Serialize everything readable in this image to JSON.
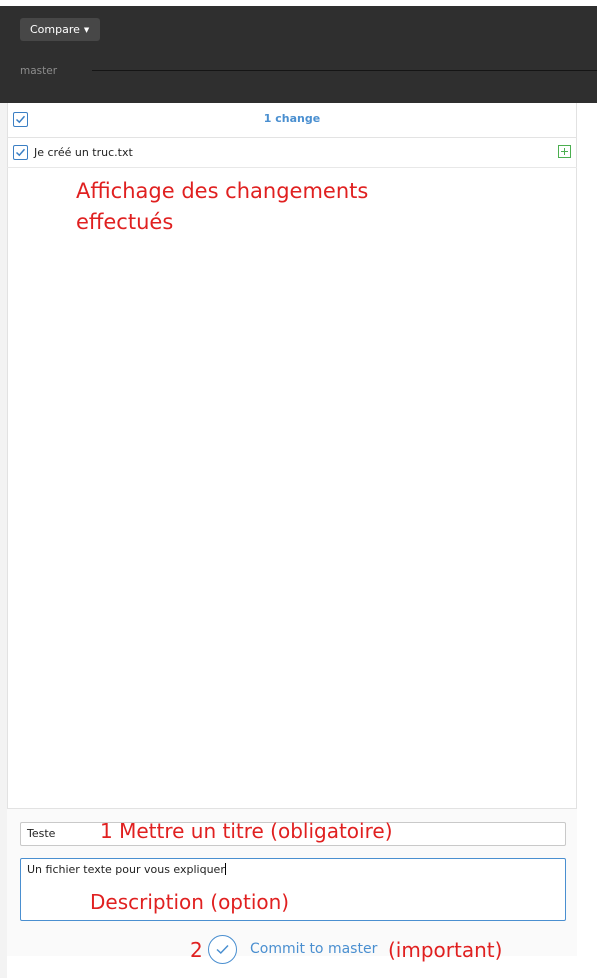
{
  "toolbar": {
    "compare_label": "Compare",
    "compare_caret_icon": "caret-down-icon",
    "branch_label": "master"
  },
  "changes": {
    "count_label": "1 change",
    "files": [
      {
        "name": "Je créé un truc.txt",
        "checked": true,
        "status_icon": "plus-square-icon"
      }
    ]
  },
  "annotations": {
    "changes_area": "Affichage des changements effectués",
    "title_hint": "1 Mettre un titre (obligatoire)",
    "description_hint": "Description (option)",
    "step_number": "2",
    "important": "(important)"
  },
  "commit_form": {
    "title_value": "Teste",
    "description_value": "Un fichier texte pour vous expliquer",
    "commit_label": "Commit to master",
    "commit_icon": "check-circle-icon"
  },
  "colors": {
    "accent": "#4a8fd0",
    "annotation": "#e02020",
    "dark_bar": "#2f2f2f",
    "add_status": "#4caf50"
  }
}
